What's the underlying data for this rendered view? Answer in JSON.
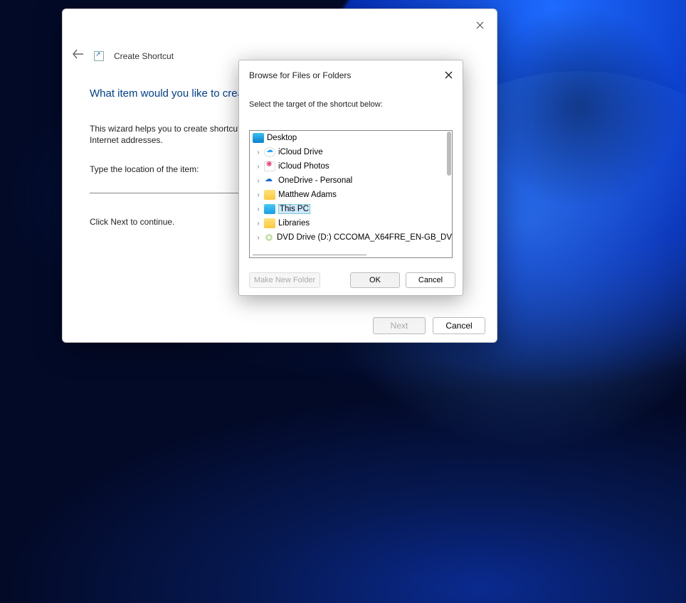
{
  "wizard": {
    "title": "Create Shortcut",
    "question": "What item would you like to create a shortcut for?",
    "description": "This wizard helps you to create shortcuts to local or network programs, files, folders, computers, or Internet addresses.",
    "location_label": "Type the location of the item:",
    "location_value": "",
    "continue_hint": "Click Next to continue.",
    "next_label": "Next",
    "cancel_label": "Cancel"
  },
  "browse": {
    "title": "Browse for Files or Folders",
    "instruction": "Select the target of the shortcut below:",
    "make_new_folder_label": "Make New Folder",
    "ok_label": "OK",
    "cancel_label": "Cancel",
    "tree": {
      "root": {
        "label": "Desktop",
        "icon": "desktop"
      },
      "items": [
        {
          "label": "iCloud Drive",
          "icon": "cloud"
        },
        {
          "label": "iCloud Photos",
          "icon": "photos"
        },
        {
          "label": "OneDrive - Personal",
          "icon": "onedrive"
        },
        {
          "label": "Matthew Adams",
          "icon": "folder"
        },
        {
          "label": "This PC",
          "icon": "pc",
          "selected": true
        },
        {
          "label": "Libraries",
          "icon": "folder"
        },
        {
          "label": "DVD Drive (D:) CCCOMA_X64FRE_EN-GB_DV",
          "icon": "dvd"
        }
      ]
    }
  }
}
